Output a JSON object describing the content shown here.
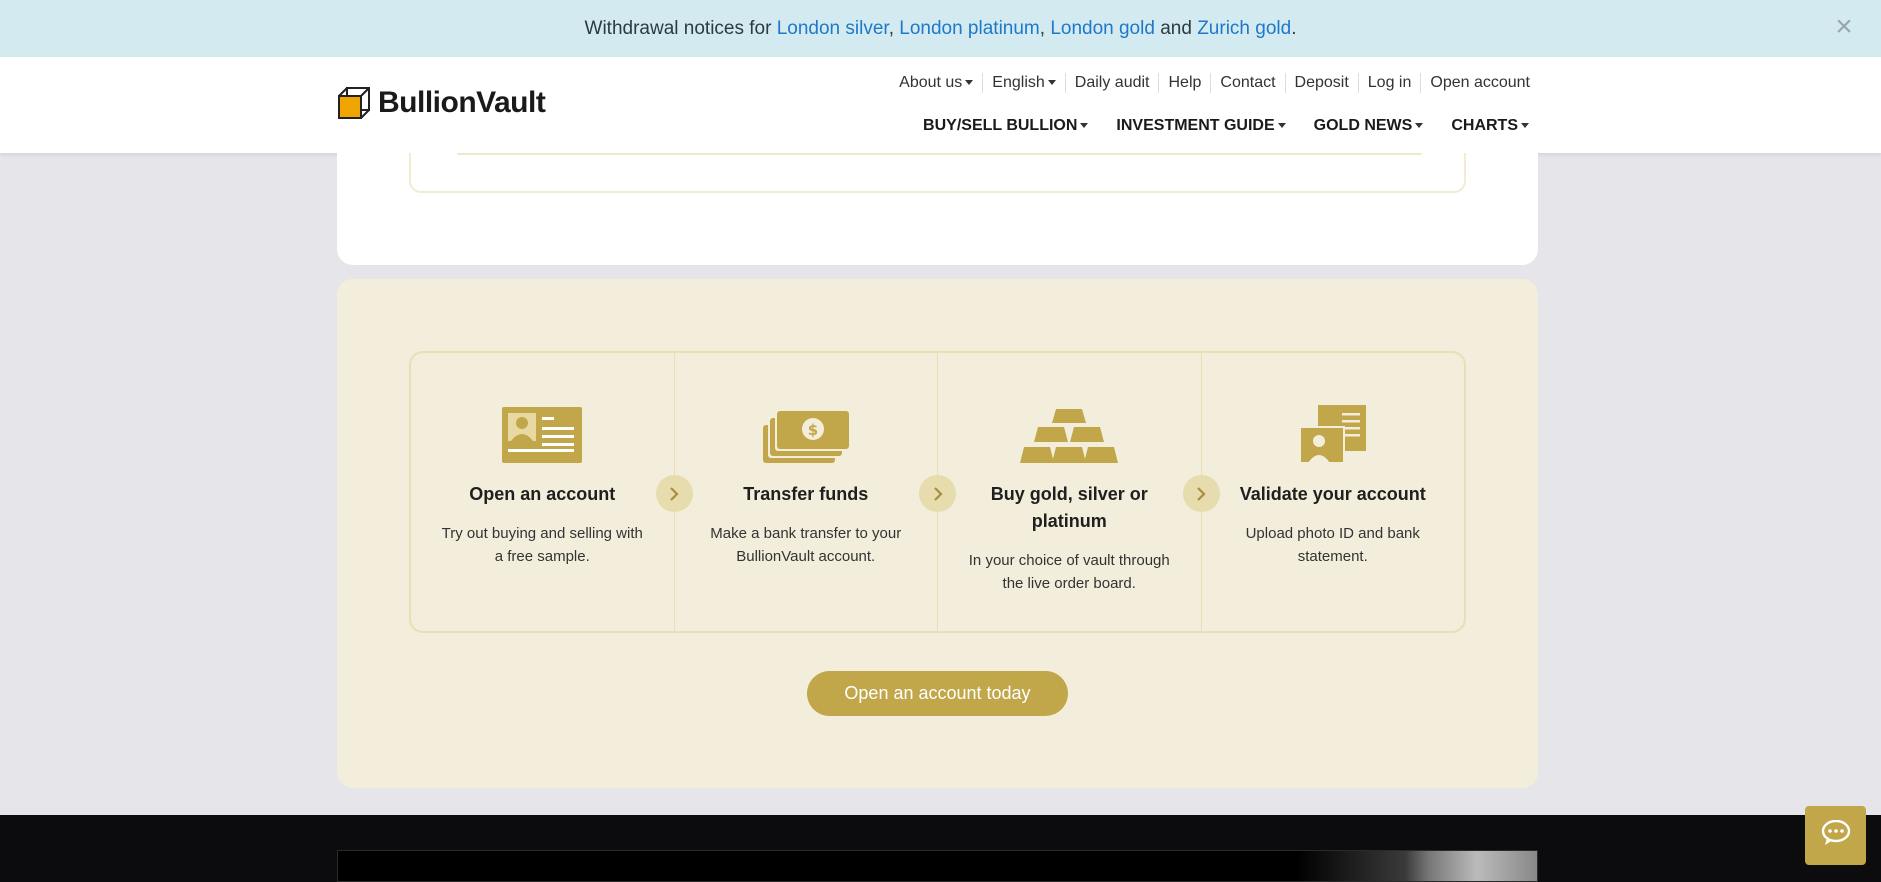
{
  "notice": {
    "prefix": "Withdrawal notices for ",
    "link1": "London silver",
    "sep1": ", ",
    "link2": "London platinum",
    "sep2": ", ",
    "link3": "London gold",
    "and": " and ",
    "link4": "Zurich gold",
    "end": ".",
    "link_color": "#1f78c8",
    "close_icon": "close-icon"
  },
  "header": {
    "logo_text": "BullionVault",
    "top_nav": [
      "About us",
      "English",
      "Daily audit",
      "Help",
      "Contact",
      "Deposit",
      "Log in",
      "Open account"
    ],
    "main_nav": [
      "BUY/SELL BULLION",
      "INVESTMENT GUIDE",
      "GOLD NEWS",
      "CHARTS"
    ]
  },
  "steps": [
    {
      "icon": "id-card-icon",
      "title": "Open an account",
      "text": "Try out buying and selling with a free sample."
    },
    {
      "icon": "banknotes-icon",
      "title": "Transfer funds",
      "text": "Make a bank transfer to your BullionVault account."
    },
    {
      "icon": "gold-bars-icon",
      "title": "Buy gold, silver or platinum",
      "text": "In your choice of vault through the live order board."
    },
    {
      "icon": "id-documents-icon",
      "title": "Validate your account",
      "text": "Upload photo ID and bank statement."
    }
  ],
  "cta": {
    "label": "Open an account today"
  },
  "colors": {
    "gold": "#c2a64a",
    "panel_bg": "#f2eedb",
    "notice_bg": "#d3ebf0"
  },
  "chat": {
    "icon": "chat-icon"
  }
}
